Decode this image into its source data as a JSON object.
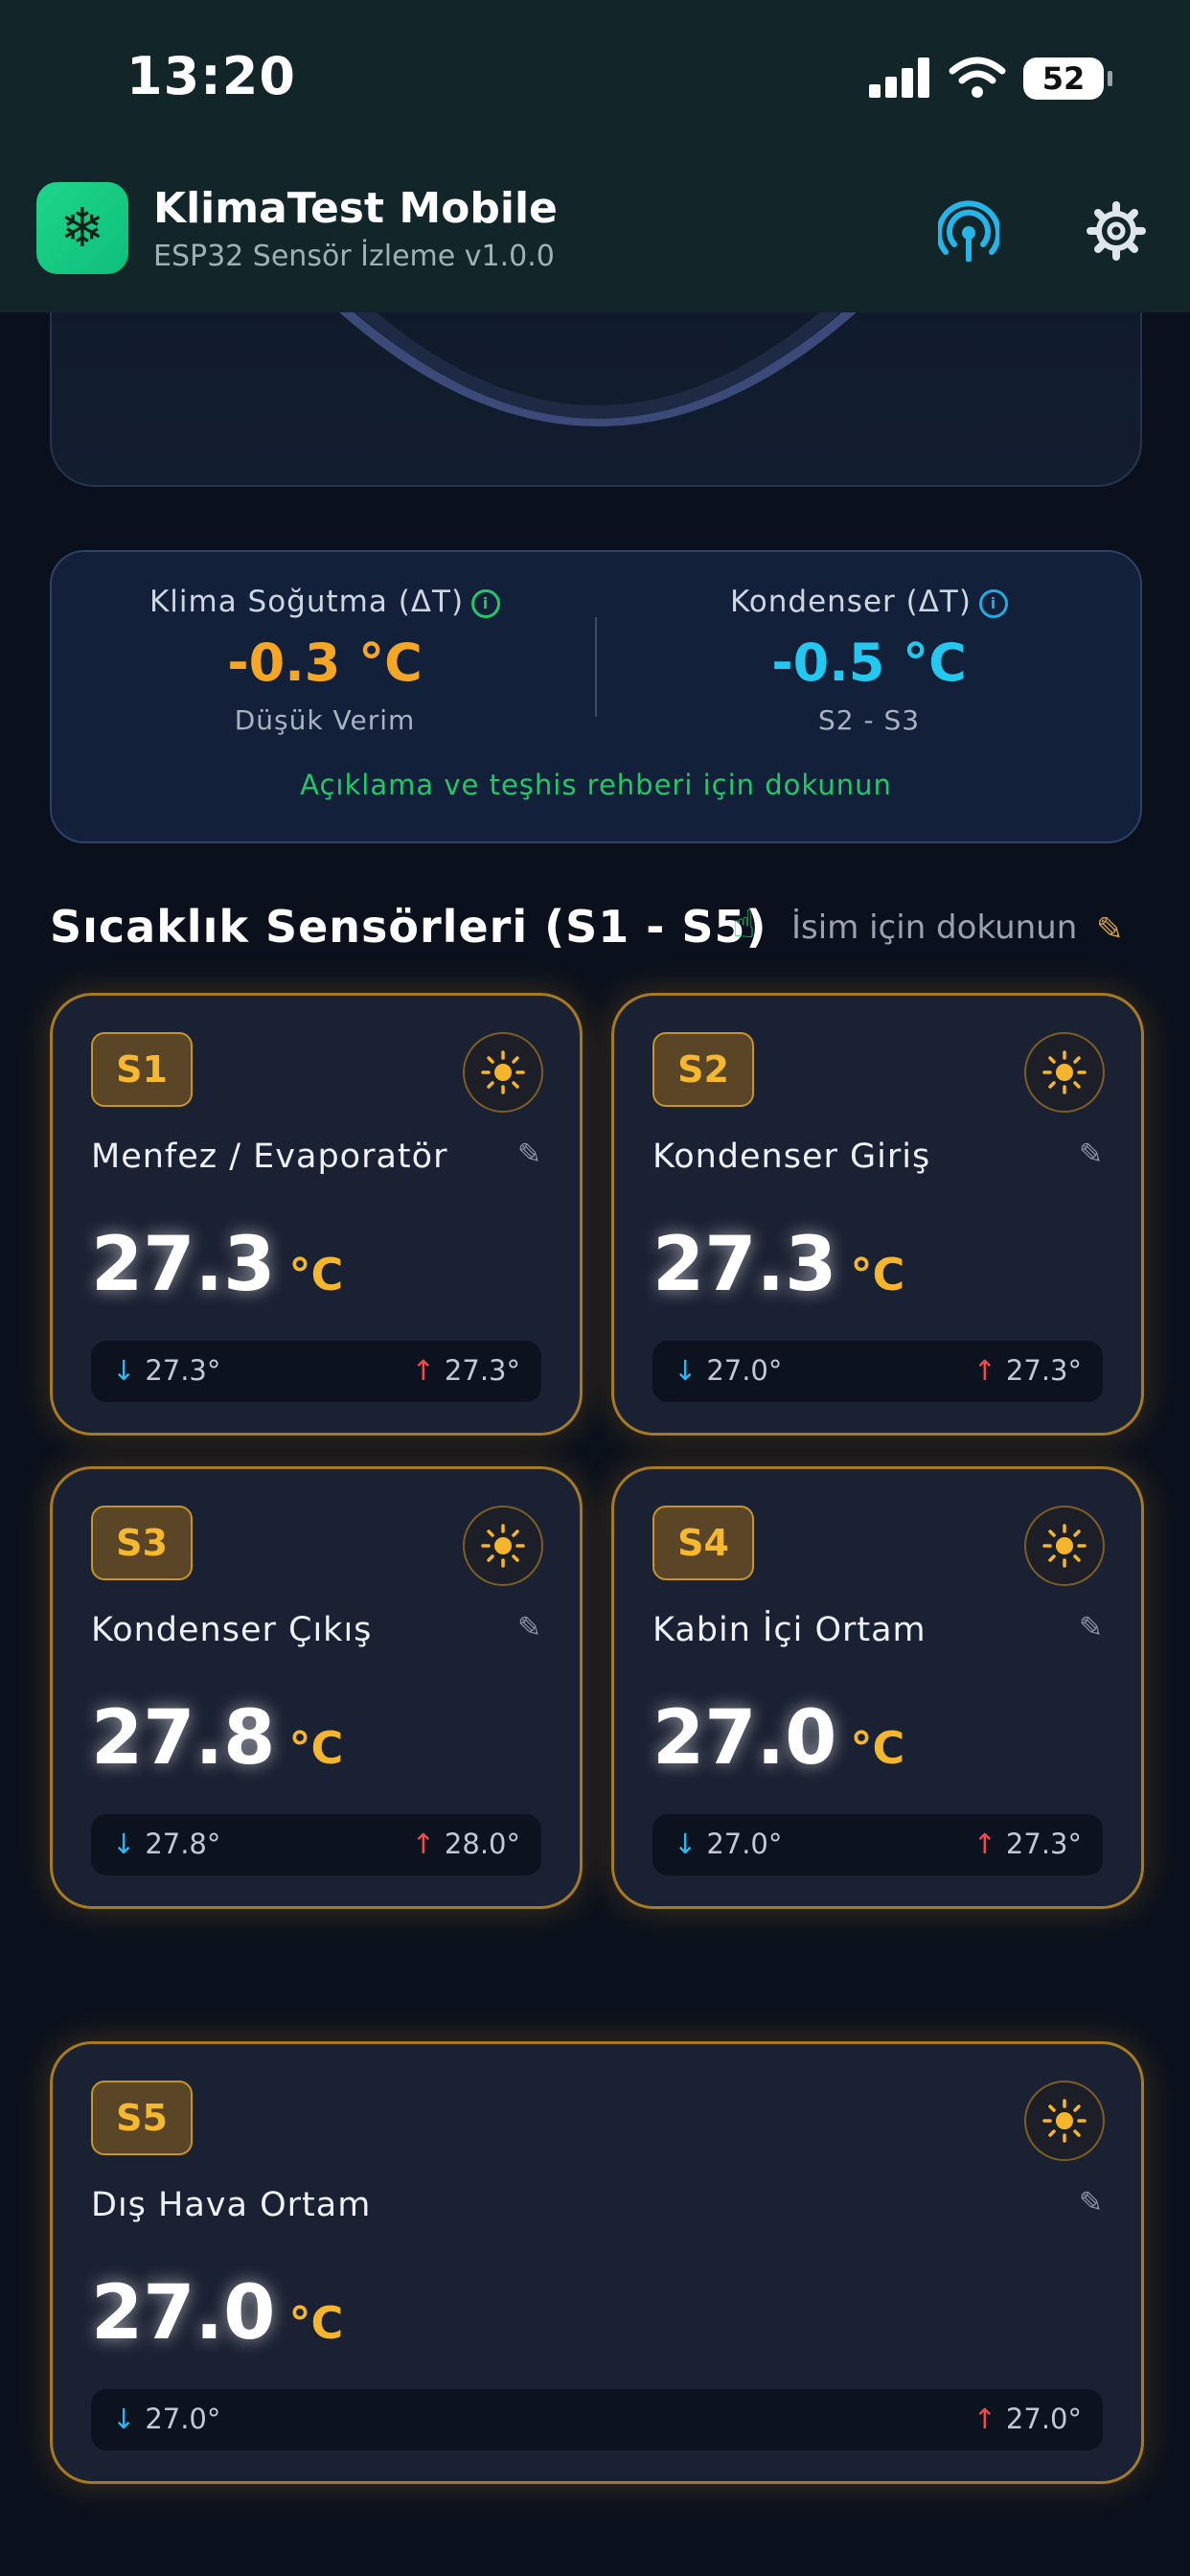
{
  "status_bar": {
    "time": "13:20",
    "battery": "52"
  },
  "header": {
    "app_name": "KlimaTest Mobile",
    "subtitle": "ESP32 Sensör İzleme v1.0.0",
    "icons": {
      "app": "snowflake-icon",
      "connection": "broadcast-icon",
      "settings": "gear-icon"
    }
  },
  "delta": {
    "left": {
      "title": "Klima Soğutma (ΔT)",
      "value": "-0.3 °C",
      "sub": "Düşük Verim",
      "color": "#f5a623"
    },
    "right": {
      "title": "Kondenser (ΔT)",
      "value": "-0.5 °C",
      "sub": "S2 - S3",
      "color": "#22c8f0"
    },
    "hint": "Açıklama ve teşhis rehberi için dokunun"
  },
  "section": {
    "title": "Sıcaklık Sensörleri (S1 - S5)",
    "hint": "İsim için dokunun"
  },
  "sensors": [
    {
      "id": "S1",
      "name": "Menfez / Evaporatör",
      "temp": "27.3",
      "unit": "°C",
      "min": "27.3°",
      "max": "27.3°"
    },
    {
      "id": "S2",
      "name": "Kondenser Giriş",
      "temp": "27.3",
      "unit": "°C",
      "min": "27.0°",
      "max": "27.3°"
    },
    {
      "id": "S3",
      "name": "Kondenser Çıkış",
      "temp": "27.8",
      "unit": "°C",
      "min": "27.8°",
      "max": "28.0°"
    },
    {
      "id": "S4",
      "name": "Kabin İçi Ortam",
      "temp": "27.0",
      "unit": "°C",
      "min": "27.0°",
      "max": "27.3°"
    },
    {
      "id": "S5",
      "name": "Dış Hava Ortam",
      "temp": "27.0",
      "unit": "°C",
      "min": "27.0°",
      "max": "27.0°"
    }
  ],
  "colors": {
    "accent": "#f5b62c",
    "positive": "#22c768",
    "down_arrow": "#35b4f0",
    "up_arrow": "#f04c4c"
  }
}
